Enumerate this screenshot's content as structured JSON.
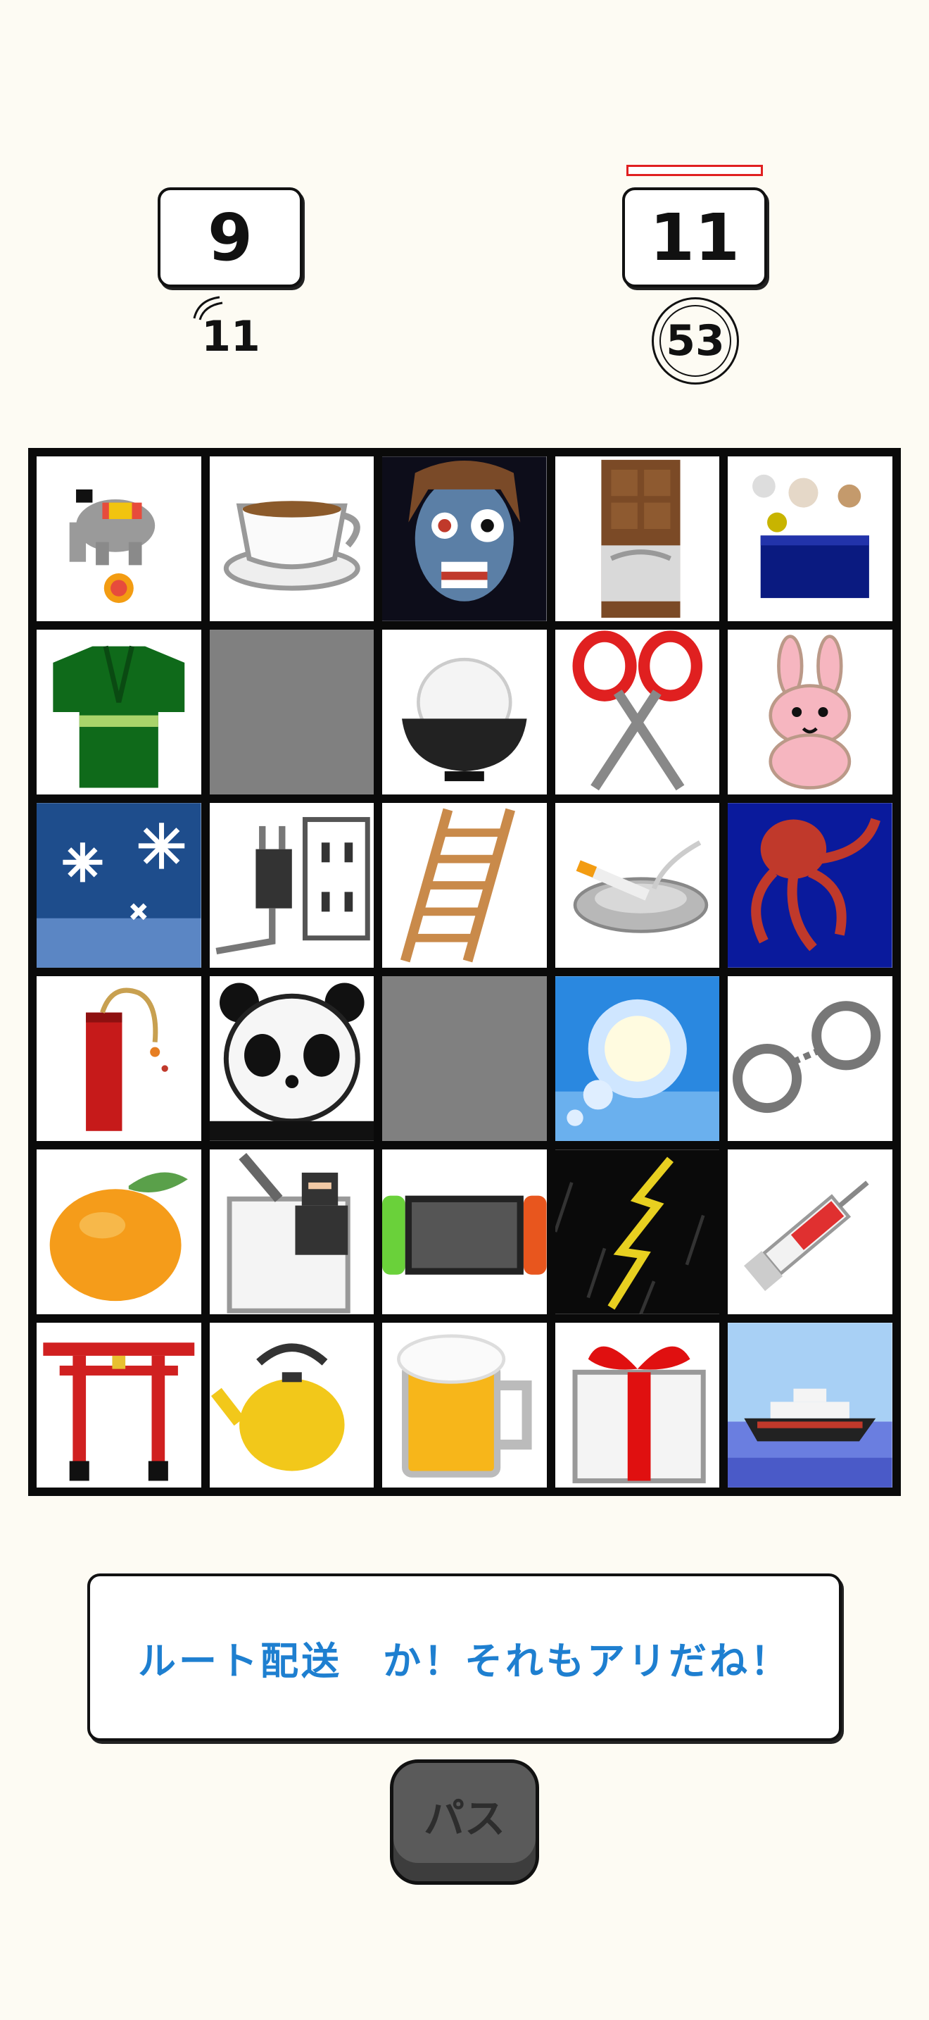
{
  "scores": {
    "left_main": "9",
    "left_sub": "11",
    "right_main": "11",
    "right_sub": "53"
  },
  "message": "ルート配送　か！それもアリだね！",
  "pass_label": "パス",
  "board": {
    "rows": 6,
    "cols": 5,
    "tiles": [
      "circus-elephant",
      "teacup",
      "zombie",
      "chocolate-bar",
      "bubbles-box",
      "kimono",
      "empty",
      "rice-bowl",
      "scissors",
      "rabbit",
      "snowflakes",
      "power-plug",
      "ladder",
      "ashtray",
      "octopus",
      "dynamite",
      "panda",
      "empty",
      "sun",
      "handcuffs",
      "mandarin-orange",
      "ninja",
      "game-console",
      "lightning",
      "syringe",
      "torii-gate",
      "kettle",
      "beer-mug",
      "gift-box",
      "ship"
    ]
  }
}
